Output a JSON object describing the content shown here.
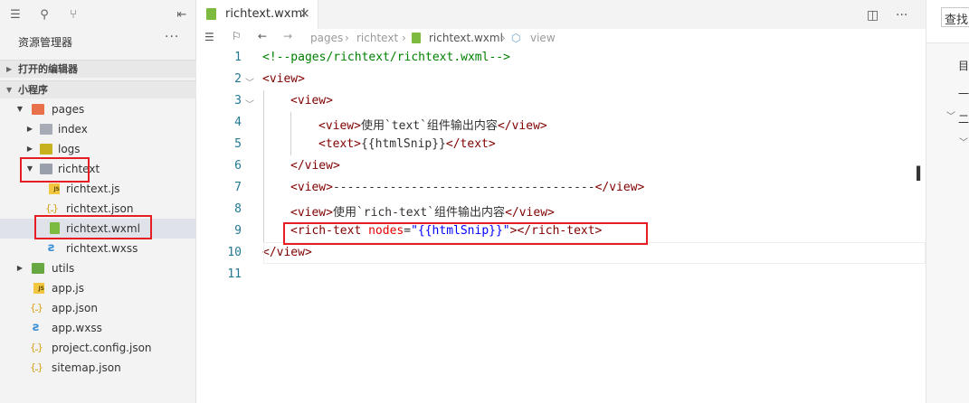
{
  "sidebar": {
    "title": "资源管理器",
    "more": "···",
    "sections": [
      {
        "label": "打开的编辑器"
      },
      {
        "label": "小程序"
      }
    ],
    "tree": [
      {
        "label": "pages",
        "type": "folder"
      },
      {
        "label": "index",
        "type": "folder"
      },
      {
        "label": "logs",
        "type": "folder"
      },
      {
        "label": "richtext",
        "type": "folder"
      },
      {
        "label": "richtext.js",
        "type": "js"
      },
      {
        "label": "richtext.json",
        "type": "json"
      },
      {
        "label": "richtext.wxml",
        "type": "wxml"
      },
      {
        "label": "richtext.wxss",
        "type": "wxss"
      },
      {
        "label": "utils",
        "type": "folder"
      },
      {
        "label": "app.js",
        "type": "js"
      },
      {
        "label": "app.json",
        "type": "json"
      },
      {
        "label": "app.wxss",
        "type": "wxss"
      },
      {
        "label": "project.config.json",
        "type": "json"
      },
      {
        "label": "sitemap.json",
        "type": "json"
      }
    ]
  },
  "editor": {
    "tab": {
      "label": "richtext.wxml",
      "close": "×"
    },
    "breadcrumb": [
      "pages",
      "richtext",
      "richtext.wxml",
      "view"
    ],
    "line_numbers": [
      "1",
      "2",
      "3",
      "4",
      "5",
      "6",
      "7",
      "8",
      "9",
      "10",
      "11"
    ],
    "lines": [
      {
        "segments": [
          {
            "c": "cm",
            "t": "<!--pages/richtext/richtext.wxml-->"
          }
        ]
      },
      {
        "segments": [
          {
            "c": "tg",
            "t": "<view>"
          }
        ]
      },
      {
        "segments": [
          {
            "c": "tg",
            "t": "<view>"
          }
        ]
      },
      {
        "segments": [
          {
            "c": "tg",
            "t": "<view>"
          },
          {
            "c": "",
            "t": "使用`text`组件输出内容"
          },
          {
            "c": "tg",
            "t": "</view>"
          }
        ]
      },
      {
        "segments": [
          {
            "c": "tg",
            "t": "<text>"
          },
          {
            "c": "",
            "t": "{{htmlSnip}}"
          },
          {
            "c": "tg",
            "t": "</text>"
          }
        ]
      },
      {
        "segments": [
          {
            "c": "tg",
            "t": "</view>"
          }
        ]
      },
      {
        "segments": [
          {
            "c": "tg",
            "t": "<view>"
          },
          {
            "c": "",
            "t": "-------------------------------------"
          },
          {
            "c": "tg",
            "t": "</view>"
          }
        ]
      },
      {
        "segments": [
          {
            "c": "tg",
            "t": "<view>"
          },
          {
            "c": "",
            "t": "使用`rich-text`组件输出内容"
          },
          {
            "c": "tg",
            "t": "</view>"
          }
        ]
      },
      {
        "segments": [
          {
            "c": "tg",
            "t": "<rich-text "
          },
          {
            "c": "at",
            "t": "nodes"
          },
          {
            "c": "",
            "t": "="
          },
          {
            "c": "st",
            "t": "\"{{htmlSnip}}\""
          },
          {
            "c": "tg",
            "t": "></rich-text>"
          }
        ]
      },
      {
        "segments": [
          {
            "c": "tg",
            "t": "</view>"
          }
        ]
      },
      {
        "segments": []
      }
    ]
  },
  "right_panel": {
    "search_value": "查找",
    "items": [
      "目",
      "一",
      "二",
      ""
    ]
  },
  "colors": {
    "highlight_box": "#e61e23",
    "tag": "#800000",
    "comment": "#008000",
    "line_number": "#237893"
  }
}
